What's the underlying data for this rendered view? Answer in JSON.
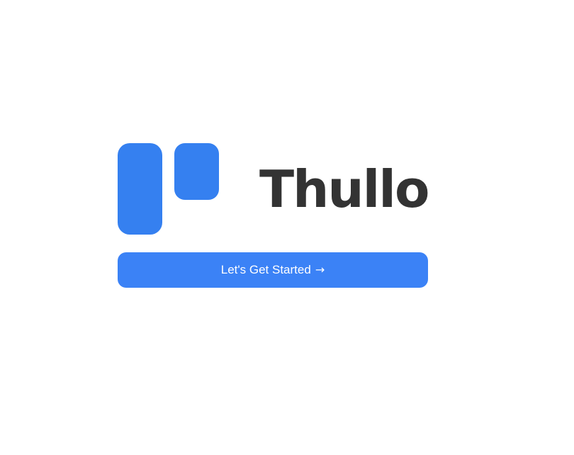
{
  "app": {
    "brand_name": "Thullo",
    "brand_color": "#3580F0",
    "text_color": "#333333"
  },
  "logo": {
    "icon": "board-columns-logo-icon"
  },
  "cta": {
    "label": "Let's Get Started",
    "icon": "arrow-right-icon",
    "icon_glyph": "→",
    "background": "#3B82F6"
  }
}
